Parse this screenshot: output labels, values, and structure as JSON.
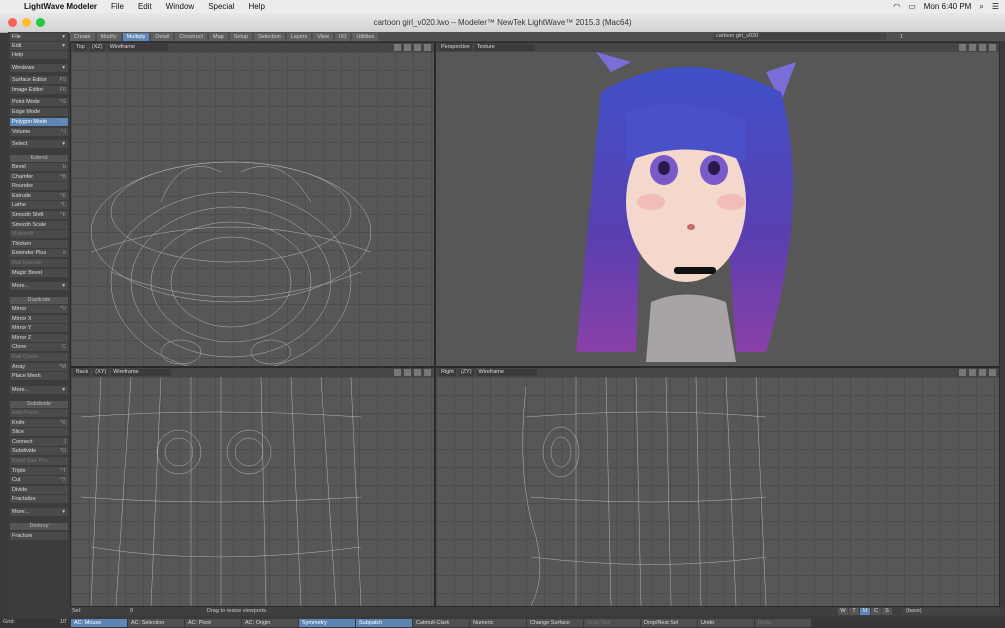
{
  "menubar": {
    "app_name": "LightWave Modeler",
    "items": [
      "File",
      "Edit",
      "Window",
      "Special",
      "Help"
    ],
    "clock": "Mon 6:40 PM"
  },
  "window": {
    "title": "cartoon girl_v020.lwo – Modeler™ NewTek LightWave™ 2015.3 (Mac64)"
  },
  "tabs": [
    {
      "label": "Create",
      "active": false
    },
    {
      "label": "Modify",
      "active": false
    },
    {
      "label": "Multiply",
      "active": true
    },
    {
      "label": "Detail",
      "active": false
    },
    {
      "label": "Construct",
      "active": false
    },
    {
      "label": "Map",
      "active": false
    },
    {
      "label": "Setup",
      "active": false
    },
    {
      "label": "Selection",
      "active": false
    },
    {
      "label": "Layers",
      "active": false
    },
    {
      "label": "View",
      "active": false
    },
    {
      "label": "I/O",
      "active": false
    },
    {
      "label": "Utilities",
      "active": false
    }
  ],
  "object_name": "cartoon girl_v020",
  "layer_number": "1",
  "sidebar": {
    "top_menus": [
      "File",
      "Edit",
      "Help"
    ],
    "windows": "Windows",
    "editors": [
      {
        "label": "Surface Editor",
        "key": "F5"
      },
      {
        "label": "Image Editor",
        "key": "F6"
      }
    ],
    "modes": [
      {
        "label": "Point Mode",
        "key": "^G",
        "active": false
      },
      {
        "label": "Edge Mode",
        "key": "",
        "active": false
      },
      {
        "label": "Polygon Mode",
        "key": "^H",
        "active": true
      },
      {
        "label": "Volume",
        "key": "^J",
        "active": false
      }
    ],
    "select": "Select",
    "extend_header": "Extend",
    "extend": [
      {
        "label": "Bevel",
        "key": "b",
        "dim": false
      },
      {
        "label": "Chamfer",
        "key": "^B",
        "dim": false
      },
      {
        "label": "Rounder",
        "key": "",
        "dim": false
      },
      {
        "label": "Extrude",
        "key": "^E",
        "dim": false
      },
      {
        "label": "Lathe",
        "key": "^L",
        "dim": false
      },
      {
        "label": "Smooth Shift",
        "key": "^F",
        "dim": false
      },
      {
        "label": "Smooth Scale",
        "key": "",
        "dim": false
      },
      {
        "label": "Multishift",
        "key": "",
        "dim": true
      },
      {
        "label": "Thicken",
        "key": "",
        "dim": false
      },
      {
        "label": "Extender Plus",
        "key": "e",
        "dim": false
      },
      {
        "label": "Rail Extrude",
        "key": "",
        "dim": true
      },
      {
        "label": "Magic Bevel",
        "key": "",
        "dim": false
      }
    ],
    "more1": "More...",
    "duplicate_header": "Duplicate",
    "duplicate": [
      {
        "label": "Mirror",
        "key": "^V",
        "dim": false
      },
      {
        "label": "Mirror X",
        "key": "",
        "dim": false
      },
      {
        "label": "Mirror Y",
        "key": "",
        "dim": false
      },
      {
        "label": "Mirror Z",
        "key": "",
        "dim": false
      },
      {
        "label": "Clone",
        "key": "C",
        "dim": false
      },
      {
        "label": "Rail Clone",
        "key": "",
        "dim": true
      },
      {
        "label": "Array",
        "key": "^M",
        "dim": false
      },
      {
        "label": "Place Mesh",
        "key": "",
        "dim": false
      }
    ],
    "more2": "More...",
    "subdivide_header": "Subdivide",
    "subdivide": [
      {
        "label": "Add Points",
        "key": "",
        "dim": true
      },
      {
        "label": "Knife",
        "key": "^K",
        "dim": false
      },
      {
        "label": "Slice",
        "key": "",
        "dim": false
      },
      {
        "label": "Connect",
        "key": "J",
        "dim": false
      },
      {
        "label": "Subdivide",
        "key": "^D",
        "dim": false
      },
      {
        "label": "Band Saw Pro",
        "key": "",
        "dim": true
      },
      {
        "label": "Triple",
        "key": "^T",
        "dim": false
      },
      {
        "label": "Cut",
        "key": "^X",
        "dim": false
      },
      {
        "label": "Divide",
        "key": "",
        "dim": false
      },
      {
        "label": "Fractalize",
        "key": "",
        "dim": false
      }
    ],
    "more3": "More...",
    "destroy_header": "Destroy",
    "destroy": [
      {
        "label": "Fracture"
      }
    ]
  },
  "viewports": {
    "top": {
      "view": "Top",
      "axis": "(XZ)",
      "shading": "Wireframe"
    },
    "persp": {
      "view": "Perspective",
      "shading": "Texture"
    },
    "back": {
      "view": "Back",
      "axis": "(XY)",
      "shading": "Wireframe"
    },
    "right": {
      "view": "Right",
      "axis": "(ZY)",
      "shading": "Wireframe"
    }
  },
  "status": {
    "sel_label": "Sel:",
    "sel_value": "0",
    "message": "Drag to resize viewports.",
    "grid_label": "Grid:",
    "grid_value": "10'"
  },
  "wtmcs": [
    "W",
    "T",
    "M",
    "C",
    "S"
  ],
  "layer_field": "(base)",
  "bottombar": [
    {
      "label": "AC: Mouse",
      "hl": true
    },
    {
      "label": "AC: Selection",
      "hl": false
    },
    {
      "label": "AC: Pivot",
      "hl": false
    },
    {
      "label": "AC: Origin",
      "hl": false
    },
    {
      "label": "Symmetry",
      "hl": true
    },
    {
      "label": "Subpatch",
      "hl": true
    },
    {
      "label": "Catmull-Clark",
      "hl": false
    },
    {
      "label": "Numeric",
      "hl": false
    },
    {
      "label": "Change Surface",
      "hl": false
    },
    {
      "label": "Drop Tool",
      "hl": false,
      "dim": true
    },
    {
      "label": "Drop/Rest Sel",
      "hl": false
    },
    {
      "label": "Undo",
      "hl": false
    },
    {
      "label": "Redo",
      "hl": false,
      "dim": true
    }
  ]
}
